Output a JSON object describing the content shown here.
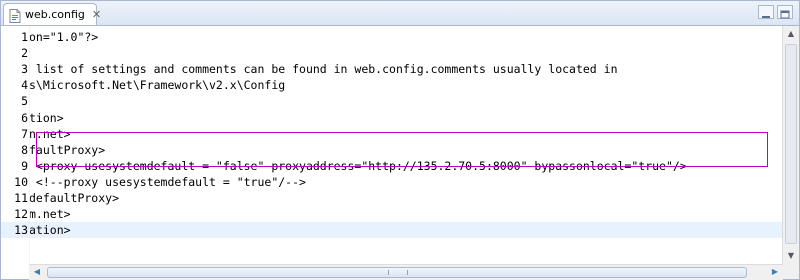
{
  "tab": {
    "label": "web.config",
    "close": "✕"
  },
  "scrollbar": {
    "up": "▲",
    "down": "▼",
    "left": "◀",
    "right": "▶"
  },
  "lines": [
    {
      "n": "1",
      "parts": [
        {
          "t": "on=\"1.0\"?>",
          "c": ""
        }
      ]
    },
    {
      "n": "2",
      "parts": []
    },
    {
      "n": "3",
      "parts": [
        {
          "t": " list of settings and comments can be found in web.config.comments usually located in",
          "c": ""
        }
      ]
    },
    {
      "n": "4",
      "parts": [
        {
          "t": "s\\Microsoft.Net\\Framework\\v2.x\\Config",
          "c": ""
        }
      ]
    },
    {
      "n": "5",
      "parts": []
    },
    {
      "n": "6",
      "parts": [
        {
          "t": "tion>",
          "c": ""
        }
      ]
    },
    {
      "n": "7",
      "parts": [
        {
          "t": "n.net>",
          "c": ""
        }
      ]
    },
    {
      "n": "8",
      "parts": [
        {
          "t": "faultProxy>",
          "c": ""
        }
      ]
    },
    {
      "n": "9",
      "parts": [
        {
          "t": " <proxy usesystemdefault = \"false\" proxyaddress=\"http://135.2.70.5:8000\" bypassonlocal=\"true\"/>",
          "c": ""
        }
      ]
    },
    {
      "n": "10",
      "parts": [
        {
          "t": " <!--proxy usesystemdefault = \"true\"/-->",
          "c": ""
        }
      ]
    },
    {
      "n": "11",
      "parts": [
        {
          "t": "defaultProxy>",
          "c": ""
        }
      ]
    },
    {
      "n": "12",
      "parts": [
        {
          "t": "m.net>",
          "c": ""
        }
      ]
    },
    {
      "n": "13",
      "parts": [
        {
          "t": "ation>",
          "c": ""
        }
      ]
    }
  ],
  "current_line": 13
}
